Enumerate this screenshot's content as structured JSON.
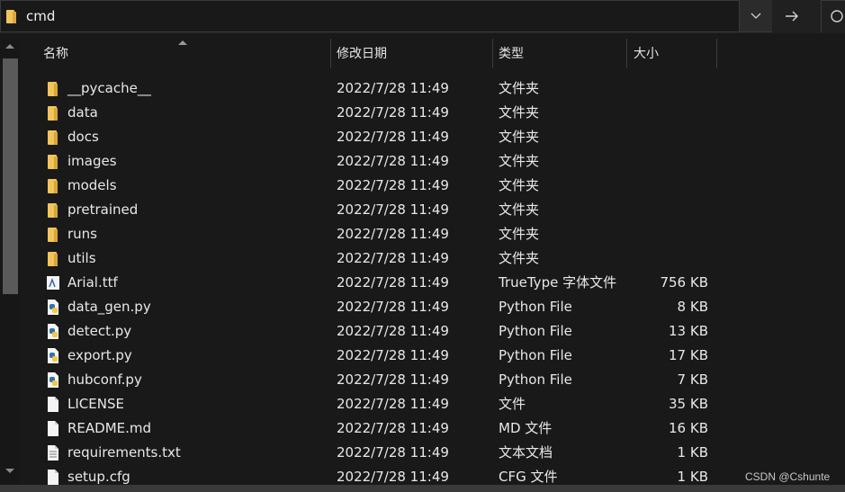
{
  "address": {
    "path": "cmd"
  },
  "columns": {
    "name": "名称",
    "date": "修改日期",
    "type": "类型",
    "size": "大小"
  },
  "files": [
    {
      "name": "__pycache__",
      "date": "2022/7/28 11:49",
      "type": "文件夹",
      "size": "",
      "icon": "folder-icon"
    },
    {
      "name": "data",
      "date": "2022/7/28 11:49",
      "type": "文件夹",
      "size": "",
      "icon": "folder-icon"
    },
    {
      "name": "docs",
      "date": "2022/7/28 11:49",
      "type": "文件夹",
      "size": "",
      "icon": "folder-icon"
    },
    {
      "name": "images",
      "date": "2022/7/28 11:49",
      "type": "文件夹",
      "size": "",
      "icon": "folder-icon"
    },
    {
      "name": "models",
      "date": "2022/7/28 11:49",
      "type": "文件夹",
      "size": "",
      "icon": "folder-icon"
    },
    {
      "name": "pretrained",
      "date": "2022/7/28 11:49",
      "type": "文件夹",
      "size": "",
      "icon": "folder-icon"
    },
    {
      "name": "runs",
      "date": "2022/7/28 11:49",
      "type": "文件夹",
      "size": "",
      "icon": "folder-icon"
    },
    {
      "name": "utils",
      "date": "2022/7/28 11:49",
      "type": "文件夹",
      "size": "",
      "icon": "folder-icon"
    },
    {
      "name": "Arial.ttf",
      "date": "2022/7/28 11:49",
      "type": "TrueType 字体文件",
      "size": "756 KB",
      "icon": "font-file-icon"
    },
    {
      "name": "data_gen.py",
      "date": "2022/7/28 11:49",
      "type": "Python File",
      "size": "8 KB",
      "icon": "python-file-icon"
    },
    {
      "name": "detect.py",
      "date": "2022/7/28 11:49",
      "type": "Python File",
      "size": "13 KB",
      "icon": "python-file-icon"
    },
    {
      "name": "export.py",
      "date": "2022/7/28 11:49",
      "type": "Python File",
      "size": "17 KB",
      "icon": "python-file-icon"
    },
    {
      "name": "hubconf.py",
      "date": "2022/7/28 11:49",
      "type": "Python File",
      "size": "7 KB",
      "icon": "python-file-icon"
    },
    {
      "name": "LICENSE",
      "date": "2022/7/28 11:49",
      "type": "文件",
      "size": "35 KB",
      "icon": "file-icon"
    },
    {
      "name": "README.md",
      "date": "2022/7/28 11:49",
      "type": "MD 文件",
      "size": "16 KB",
      "icon": "file-icon"
    },
    {
      "name": "requirements.txt",
      "date": "2022/7/28 11:49",
      "type": "文本文档",
      "size": "1 KB",
      "icon": "text-file-icon"
    },
    {
      "name": "setup.cfg",
      "date": "2022/7/28 11:49",
      "type": "CFG 文件",
      "size": "1 KB",
      "icon": "file-icon"
    }
  ],
  "watermark": "CSDN @Cshunte",
  "colors": {
    "folder": "#f2c55c",
    "background": "#191919"
  }
}
